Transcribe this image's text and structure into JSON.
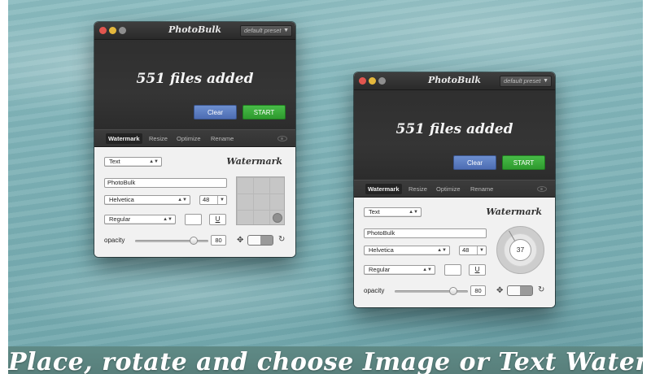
{
  "banner": {
    "text": "Place, rotate and choose Image or Text Watermark"
  },
  "windows": [
    {
      "app_title": "PhotoBulk",
      "preset": "default preset",
      "files_added": "551 files added",
      "buttons": {
        "clear": "Clear",
        "start": "START"
      },
      "tabs": [
        "Watermark",
        "Resize",
        "Optimize",
        "Rename"
      ],
      "active_tab": "Watermark",
      "panel": {
        "section_title": "Watermark",
        "type_select": "Text",
        "text_value": "PhotoBulk",
        "font_select": "Helvetica",
        "font_size": "48",
        "style_select": "Regular",
        "underline_label": "U",
        "opacity_label": "opacity",
        "opacity_value": "80",
        "opacity_fraction": 0.8,
        "preview_mode": "position-grid"
      }
    },
    {
      "app_title": "PhotoBulk",
      "preset": "default preset",
      "files_added": "551 files added",
      "buttons": {
        "clear": "Clear",
        "start": "START"
      },
      "tabs": [
        "Watermark",
        "Resize",
        "Optimize",
        "Rename"
      ],
      "active_tab": "Watermark",
      "panel": {
        "section_title": "Watermark",
        "type_select": "Text",
        "text_value": "PhotoBulk",
        "font_select": "Helvetica",
        "font_size": "48",
        "style_select": "Regular",
        "underline_label": "U",
        "opacity_label": "opacity",
        "opacity_value": "80",
        "opacity_fraction": 0.8,
        "preview_mode": "rotation-dial",
        "rotation_value": "37"
      }
    }
  ],
  "colors": {
    "clear_button": "#5577bd",
    "start_button": "#36a636",
    "window_dark": "#2f2f2f",
    "background_water": "#80b3b8",
    "banner": "#5c8581"
  },
  "icons": {
    "eye": "eye-icon",
    "move": "move-icon",
    "rotate": "rotate-icon"
  }
}
